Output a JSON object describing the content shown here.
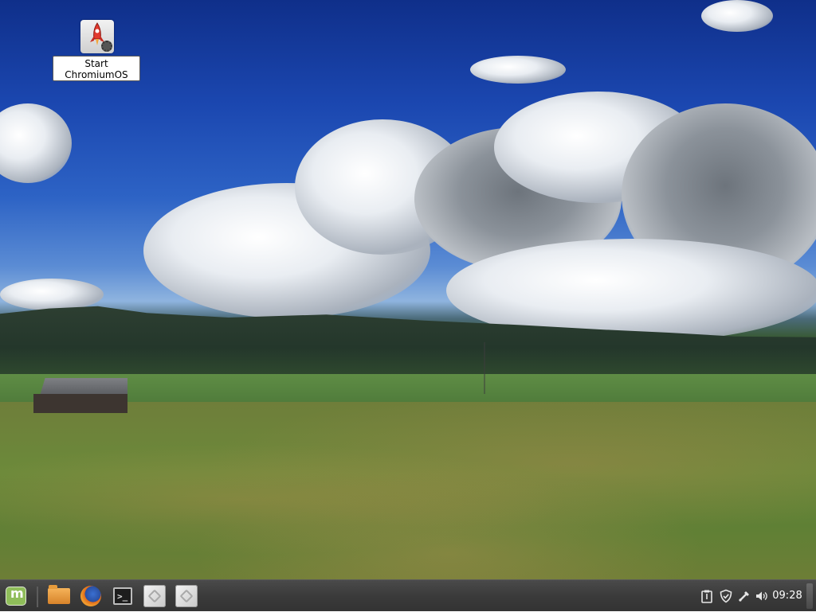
{
  "desktop": {
    "wallpaper": "grassland-with-clouds",
    "icons": [
      {
        "name": "start-chromiumos",
        "label_line1": "Start",
        "label_line2": "ChromiumOS",
        "icon": "rocket-gear-icon"
      }
    ]
  },
  "taskbar": {
    "menu_icon": "linux-mint-logo-icon",
    "launchers": [
      {
        "name": "files",
        "icon": "folder-icon"
      },
      {
        "name": "firefox",
        "icon": "firefox-icon"
      },
      {
        "name": "terminal",
        "icon": "terminal-icon",
        "glyph": ">_"
      },
      {
        "name": "app-1",
        "icon": "generic-app-icon"
      },
      {
        "name": "app-2",
        "icon": "generic-app-icon"
      }
    ],
    "tray": [
      {
        "name": "clipboard",
        "icon": "clipboard-icon"
      },
      {
        "name": "security",
        "icon": "shield-icon"
      },
      {
        "name": "network",
        "icon": "network-icon"
      },
      {
        "name": "volume",
        "icon": "speaker-icon"
      }
    ],
    "clock": "09:28"
  },
  "colors": {
    "taskbar_bg": "#3b3b3b",
    "mint_green": "#8fbd5a",
    "clock_text": "#ffffff"
  }
}
